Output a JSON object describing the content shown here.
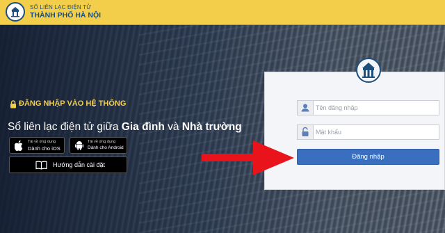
{
  "header": {
    "brand_top": "SỔ LIÊN LẠC ĐIỆN TỬ",
    "brand_main": "THÀNH PHỐ HÀ NỘI",
    "color": "#f3ce4b"
  },
  "hero": {
    "login_heading": "ĐĂNG NHẬP VÀO HỆ THỐNG",
    "tagline_prefix": "Sổ liên lạc điện tử giữa ",
    "tagline_bold1": "Gia đình",
    "tagline_mid": " và ",
    "tagline_bold2": "Nhà trường"
  },
  "apps": {
    "ios": {
      "small": "Tải về ứng dụng",
      "big": "Dành cho iOS"
    },
    "android": {
      "small": "Tải về ứng dụng",
      "big": "Dành cho Android"
    },
    "guide": "Hướng dẫn cài đặt"
  },
  "form": {
    "username_placeholder": "Tên đăng nhập",
    "password_placeholder": "Mật khẩu",
    "submit": "Đăng nhập",
    "button_color": "#3a6fbf"
  },
  "annotation": {
    "arrow_color": "#e8131b"
  }
}
